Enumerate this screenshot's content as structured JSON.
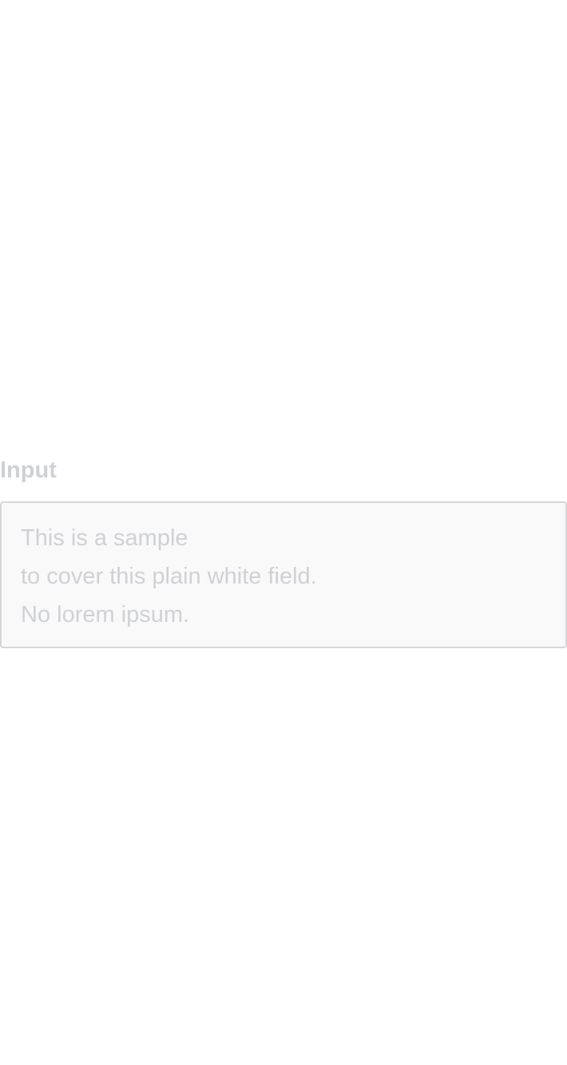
{
  "form": {
    "label": "Input",
    "textarea": {
      "lines": [
        "This is a sample",
        "to cover this plain white field.",
        "No lorem ipsum."
      ]
    }
  },
  "colors": {
    "label": "#cfd1d6",
    "text": "#cfd1d6",
    "border": "#d6d7dc",
    "field_background": "#f9f9f9",
    "page_background": "#ffffff"
  }
}
